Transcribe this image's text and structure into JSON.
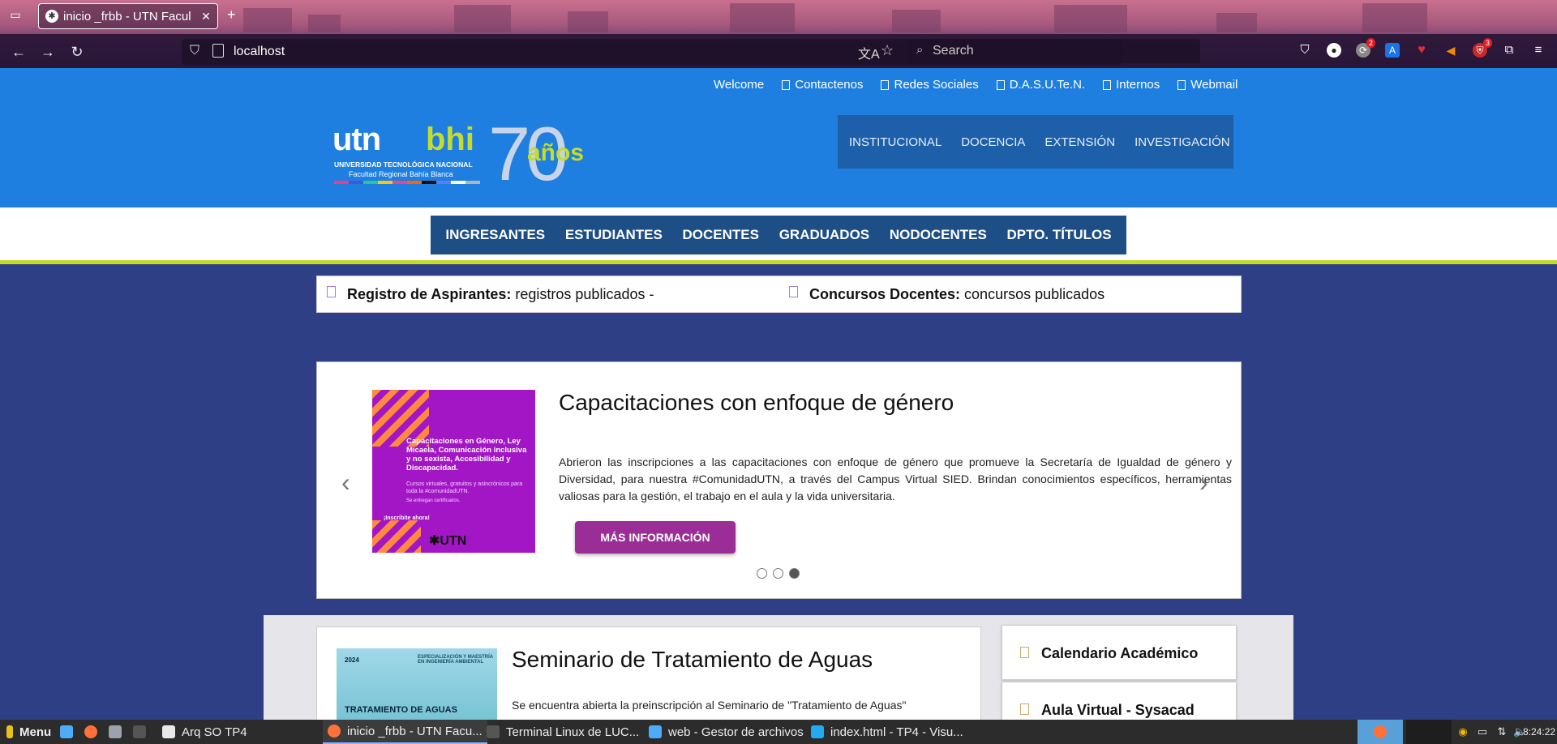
{
  "browser": {
    "tab_title": "inicio _frbb - UTN Facul",
    "url": "localhost",
    "search_placeholder": "Search",
    "ext_badge_1": "2",
    "ext_badge_2": "3"
  },
  "header": {
    "top_links": [
      "Welcome",
      "Contactenos",
      "Redes Sociales",
      "D.A.S.U.Te.N.",
      "Internos",
      "Webmail"
    ],
    "logo": {
      "utn": "utn",
      "bhi": "bhi",
      "university": "UNIVERSIDAD TECNOLÓGICA NACIONAL",
      "regional": "Facultad Regional Bahía Blanca",
      "seventy": "70",
      "anos": "años"
    },
    "main_nav": [
      "INSTITUCIONAL",
      "DOCENCIA",
      "EXTENSIÓN",
      "INVESTIGACIÓN"
    ]
  },
  "secondary_nav": [
    "INGRESANTES",
    "ESTUDIANTES",
    "DOCENTES",
    "GRADUADOS",
    "NODOCENTES",
    "DPTO. TÍTULOS"
  ],
  "ticker": {
    "item1_label": "Registro de Aspirantes:",
    "item1_text": " registros publicados -",
    "item2_label": "Concursos Docentes:",
    "item2_text": " concursos publicados"
  },
  "carousel": {
    "image_text": {
      "title": "Capacitaciones en Género, Ley Micaela, Comunicación inclusiva y no sexista, Accesibilidad y Discapacidad.",
      "sub": "Cursos virtuales, gratuitos y asincrónicos para toda la #comunidadUTN.",
      "cert": "Se entregan certificados.",
      "cta": "¡Inscribite ahora!",
      "brand": "✱UTN"
    },
    "title": "Capacitaciones con enfoque de género",
    "text": "Abrieron las inscripciones a las capacitaciones con enfoque de género que promueve la Secretaría de Igualdad de género y Diversidad, para nuestra #ComunidadUTN, a través del Campus Virtual SIED. Brindan conocimientos específicos, herramientas valiosas para la gestión, el trabajo en el aula y la vida universitaria.",
    "button": "MÁS INFORMACIÓN",
    "active_dot": 3,
    "dot_count": 3
  },
  "news": {
    "image_text": {
      "year": "2024",
      "program": "ESPECIALIZACIÓN Y MAESTRÍA EN INGENIERÍA AMBIENTAL",
      "title": "TRATAMIENTO DE AGUAS"
    },
    "title": "Seminario de Tratamiento de Aguas",
    "text": "Se encuentra abierta la preinscripción al Seminario de \"Tratamiento de Aguas\""
  },
  "sidebar": {
    "items": [
      "Calendario Académico",
      "Aula Virtual - Sysacad"
    ]
  },
  "taskbar": {
    "menu": "Menu",
    "items": [
      "Arq SO TP4",
      "inicio _frbb - UTN Facu...",
      "Terminal Linux de LUC...",
      "web - Gestor de archivos",
      "index.html - TP4 - Visu..."
    ],
    "clock": "8:24:22"
  }
}
